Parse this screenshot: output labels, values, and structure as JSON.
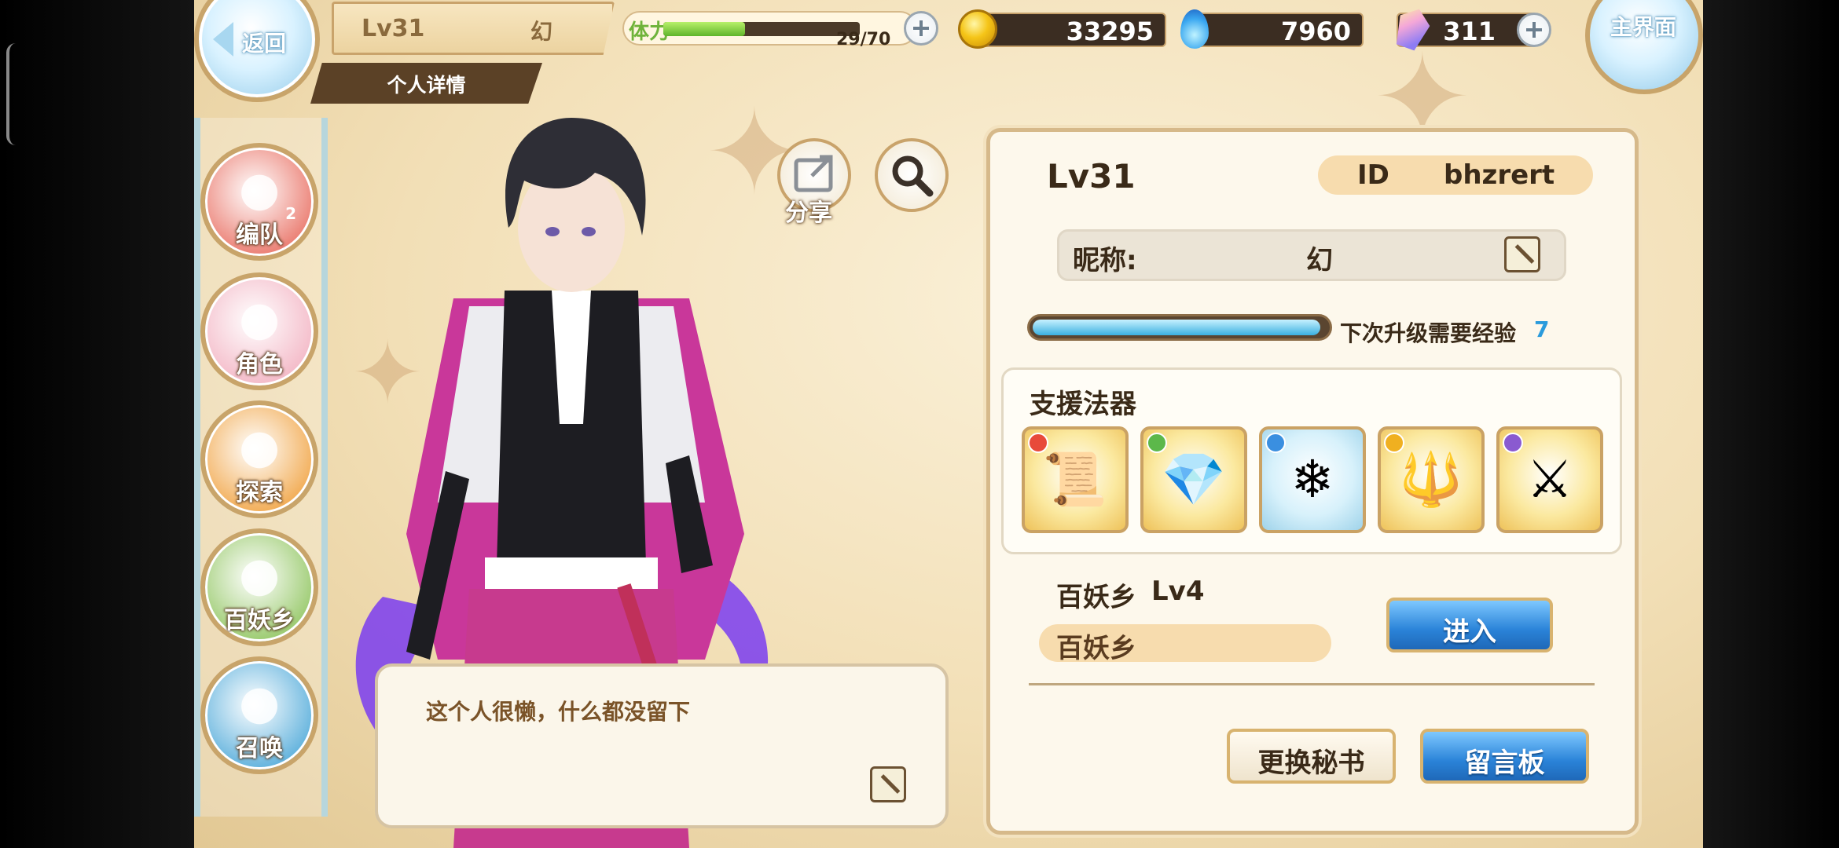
{
  "header": {
    "back_label": "返回",
    "level": "Lv31",
    "player_name": "幻",
    "detail_tab": "个人详情",
    "stamina_label": "体力",
    "stamina_text": "29/70",
    "stamina_fraction": 0.414,
    "coins": "33295",
    "spirit": "7960",
    "gems": "311",
    "home_label": "主界面"
  },
  "menu": [
    {
      "label": "编队",
      "badge": "2",
      "icon": "team-icon",
      "color": "#e86b5e"
    },
    {
      "label": "角色",
      "badge": "",
      "icon": "character-icon",
      "color": "#f2b0c0"
    },
    {
      "label": "探索",
      "badge": "",
      "icon": "explore-icon",
      "color": "#f0a03c"
    },
    {
      "label": "百妖乡",
      "badge": "",
      "icon": "village-icon",
      "color": "#8cc35a"
    },
    {
      "label": "召唤",
      "badge": "",
      "icon": "summon-icon",
      "color": "#4aa7d8"
    }
  ],
  "actions": {
    "share_label": "分享"
  },
  "bubble": {
    "message": "这个人很懒，什么都没留下"
  },
  "profile": {
    "level": "Lv31",
    "id_label": "ID",
    "id_value": "bhzrert",
    "nickname_label": "昵称:",
    "nickname_value": "幻",
    "exp_label": "下次升级需要经验",
    "exp_value": "7",
    "exp_fraction": 0.98,
    "support_title": "支援法器",
    "support_items": [
      {
        "name": "scroll-item",
        "element_color": "#e84a3a",
        "art": "📜",
        "bg": "gold"
      },
      {
        "name": "crystal-pendant-item",
        "element_color": "#5cb84a",
        "art": "💎",
        "bg": "gold"
      },
      {
        "name": "ice-crown-item",
        "element_color": "#3a8fe0",
        "art": "❄",
        "bg": "blue"
      },
      {
        "name": "golden-spear-item",
        "element_color": "#f0b020",
        "art": "🔱",
        "bg": "gold"
      },
      {
        "name": "dark-sword-item",
        "element_color": "#8a5ad0",
        "art": "⚔",
        "bg": "gold"
      }
    ],
    "village_title": "百妖乡",
    "village_level": "Lv4",
    "village_name": "百妖乡",
    "enter_label": "进入",
    "change_secretary_label": "更换秘书",
    "message_board_label": "留言板"
  },
  "colors": {
    "accent_gold": "#c9a36b",
    "button_blue": "#2a83d8",
    "exp_blue": "#2a9bdc"
  }
}
